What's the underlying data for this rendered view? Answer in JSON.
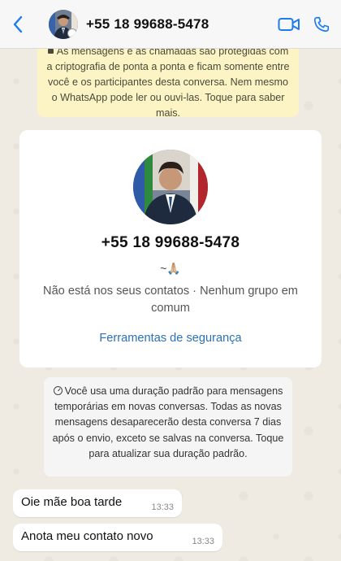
{
  "header": {
    "title": "+55 18 99688-5478",
    "back_icon": "chevron-left-icon",
    "video_icon": "video-camera-icon",
    "call_icon": "phone-icon",
    "accent_color": "#1a7cf0"
  },
  "encryption_notice": {
    "text": "As mensagens e as chamadas são protegidas com a criptografia de ponta a ponta e ficam somente entre você e os participantes desta conversa. Nem mesmo o WhatsApp pode ler ou ouvi-las. Toque para saber mais."
  },
  "profile_card": {
    "number": "+55 18 99688-5478",
    "about": "~🙏🏼",
    "status": "Não está nos seus contatos · Nenhum grupo em comum",
    "security_link": "Ferramentas de segurança"
  },
  "temporary_notice": {
    "text": "Você usa uma duração padrão para mensagens temporárias em novas conversas. Todas as novas mensagens desaparecerão desta conversa 7 dias após o envio, exceto se salvas na conversa. Toque para atualizar sua duração padrão."
  },
  "messages": [
    {
      "text": "Oie mãe boa tarde",
      "time": "13:33"
    },
    {
      "text": "Anota meu contato novo",
      "time": "13:33"
    }
  ]
}
